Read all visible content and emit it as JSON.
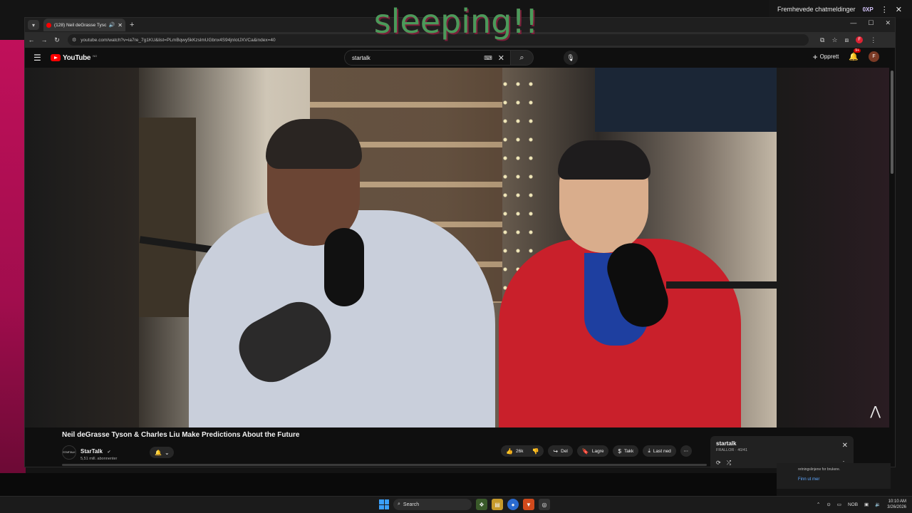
{
  "overlay": {
    "text": "sleeping!!"
  },
  "streamdeck_bar": {
    "label": "Fremhevede chatmeldinger",
    "badge": "0XP"
  },
  "browser": {
    "tab": {
      "title": "(128) Neil deGrasse Tyson &"
    },
    "url": "youtube.com/watch?v=ia7re_7g1KU&list=PLmBqwy5kKzslmUGbnx4S94jnIotJXVCa&index=40"
  },
  "youtube": {
    "logo_text": "YouTube",
    "region": "NO",
    "search": {
      "value": "startalk"
    },
    "create_label": "Opprett",
    "notif_badge": "9+",
    "avatar_letter": "F"
  },
  "video": {
    "title": "Neil deGrasse Tyson & Charles Liu Make Predictions About the Future",
    "channel": {
      "name": "StarTalk",
      "subscribers": "5,51 mill. abonnenter",
      "avatar_text": "STARTALK"
    },
    "actions": {
      "likes": "26k",
      "share": "Del",
      "save": "Lagre",
      "thanks": "Takk",
      "download": "Last ned"
    }
  },
  "playlist": {
    "title": "startalk",
    "subtitle": "FRALLOR · 40/41"
  },
  "notification": {
    "text": "retningslinjene for brukere.",
    "link": "Finn ut mer"
  },
  "taskbar": {
    "search_placeholder": "Search",
    "lang": "NOB",
    "time": "10:10 AM",
    "date": "3/26/2026"
  }
}
